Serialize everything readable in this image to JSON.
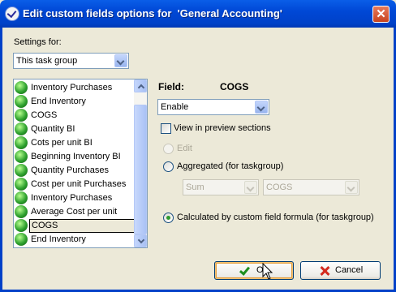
{
  "window": {
    "title": "Edit custom fields options for  'General Accounting'"
  },
  "settings": {
    "label": "Settings for:",
    "selected": "This task group"
  },
  "fields": [
    "Inventory Purchases",
    "End Inventory",
    "COGS",
    "Quantity BI",
    "Cots per unit BI",
    "Beginning Inventory BI",
    "Quantity Purchases",
    "Cost per unit Purchases",
    "Inventory Purchases",
    "Average Cost per unit",
    "COGS",
    "End Inventory"
  ],
  "selected_index": 10,
  "field": {
    "label": "Field:",
    "name": "COGS"
  },
  "enable": {
    "selected": "Enable"
  },
  "view_preview": {
    "label": "View in preview sections",
    "checked": false
  },
  "options": {
    "edit": "Edit",
    "aggregated": "Aggregated (for taskgroup)",
    "aggregate_function": "Sum",
    "aggregate_field": "COGS",
    "calculated": "Calculated by custom field formula (for taskgroup)"
  },
  "buttons": {
    "ok": "Ok",
    "cancel": "Cancel"
  }
}
